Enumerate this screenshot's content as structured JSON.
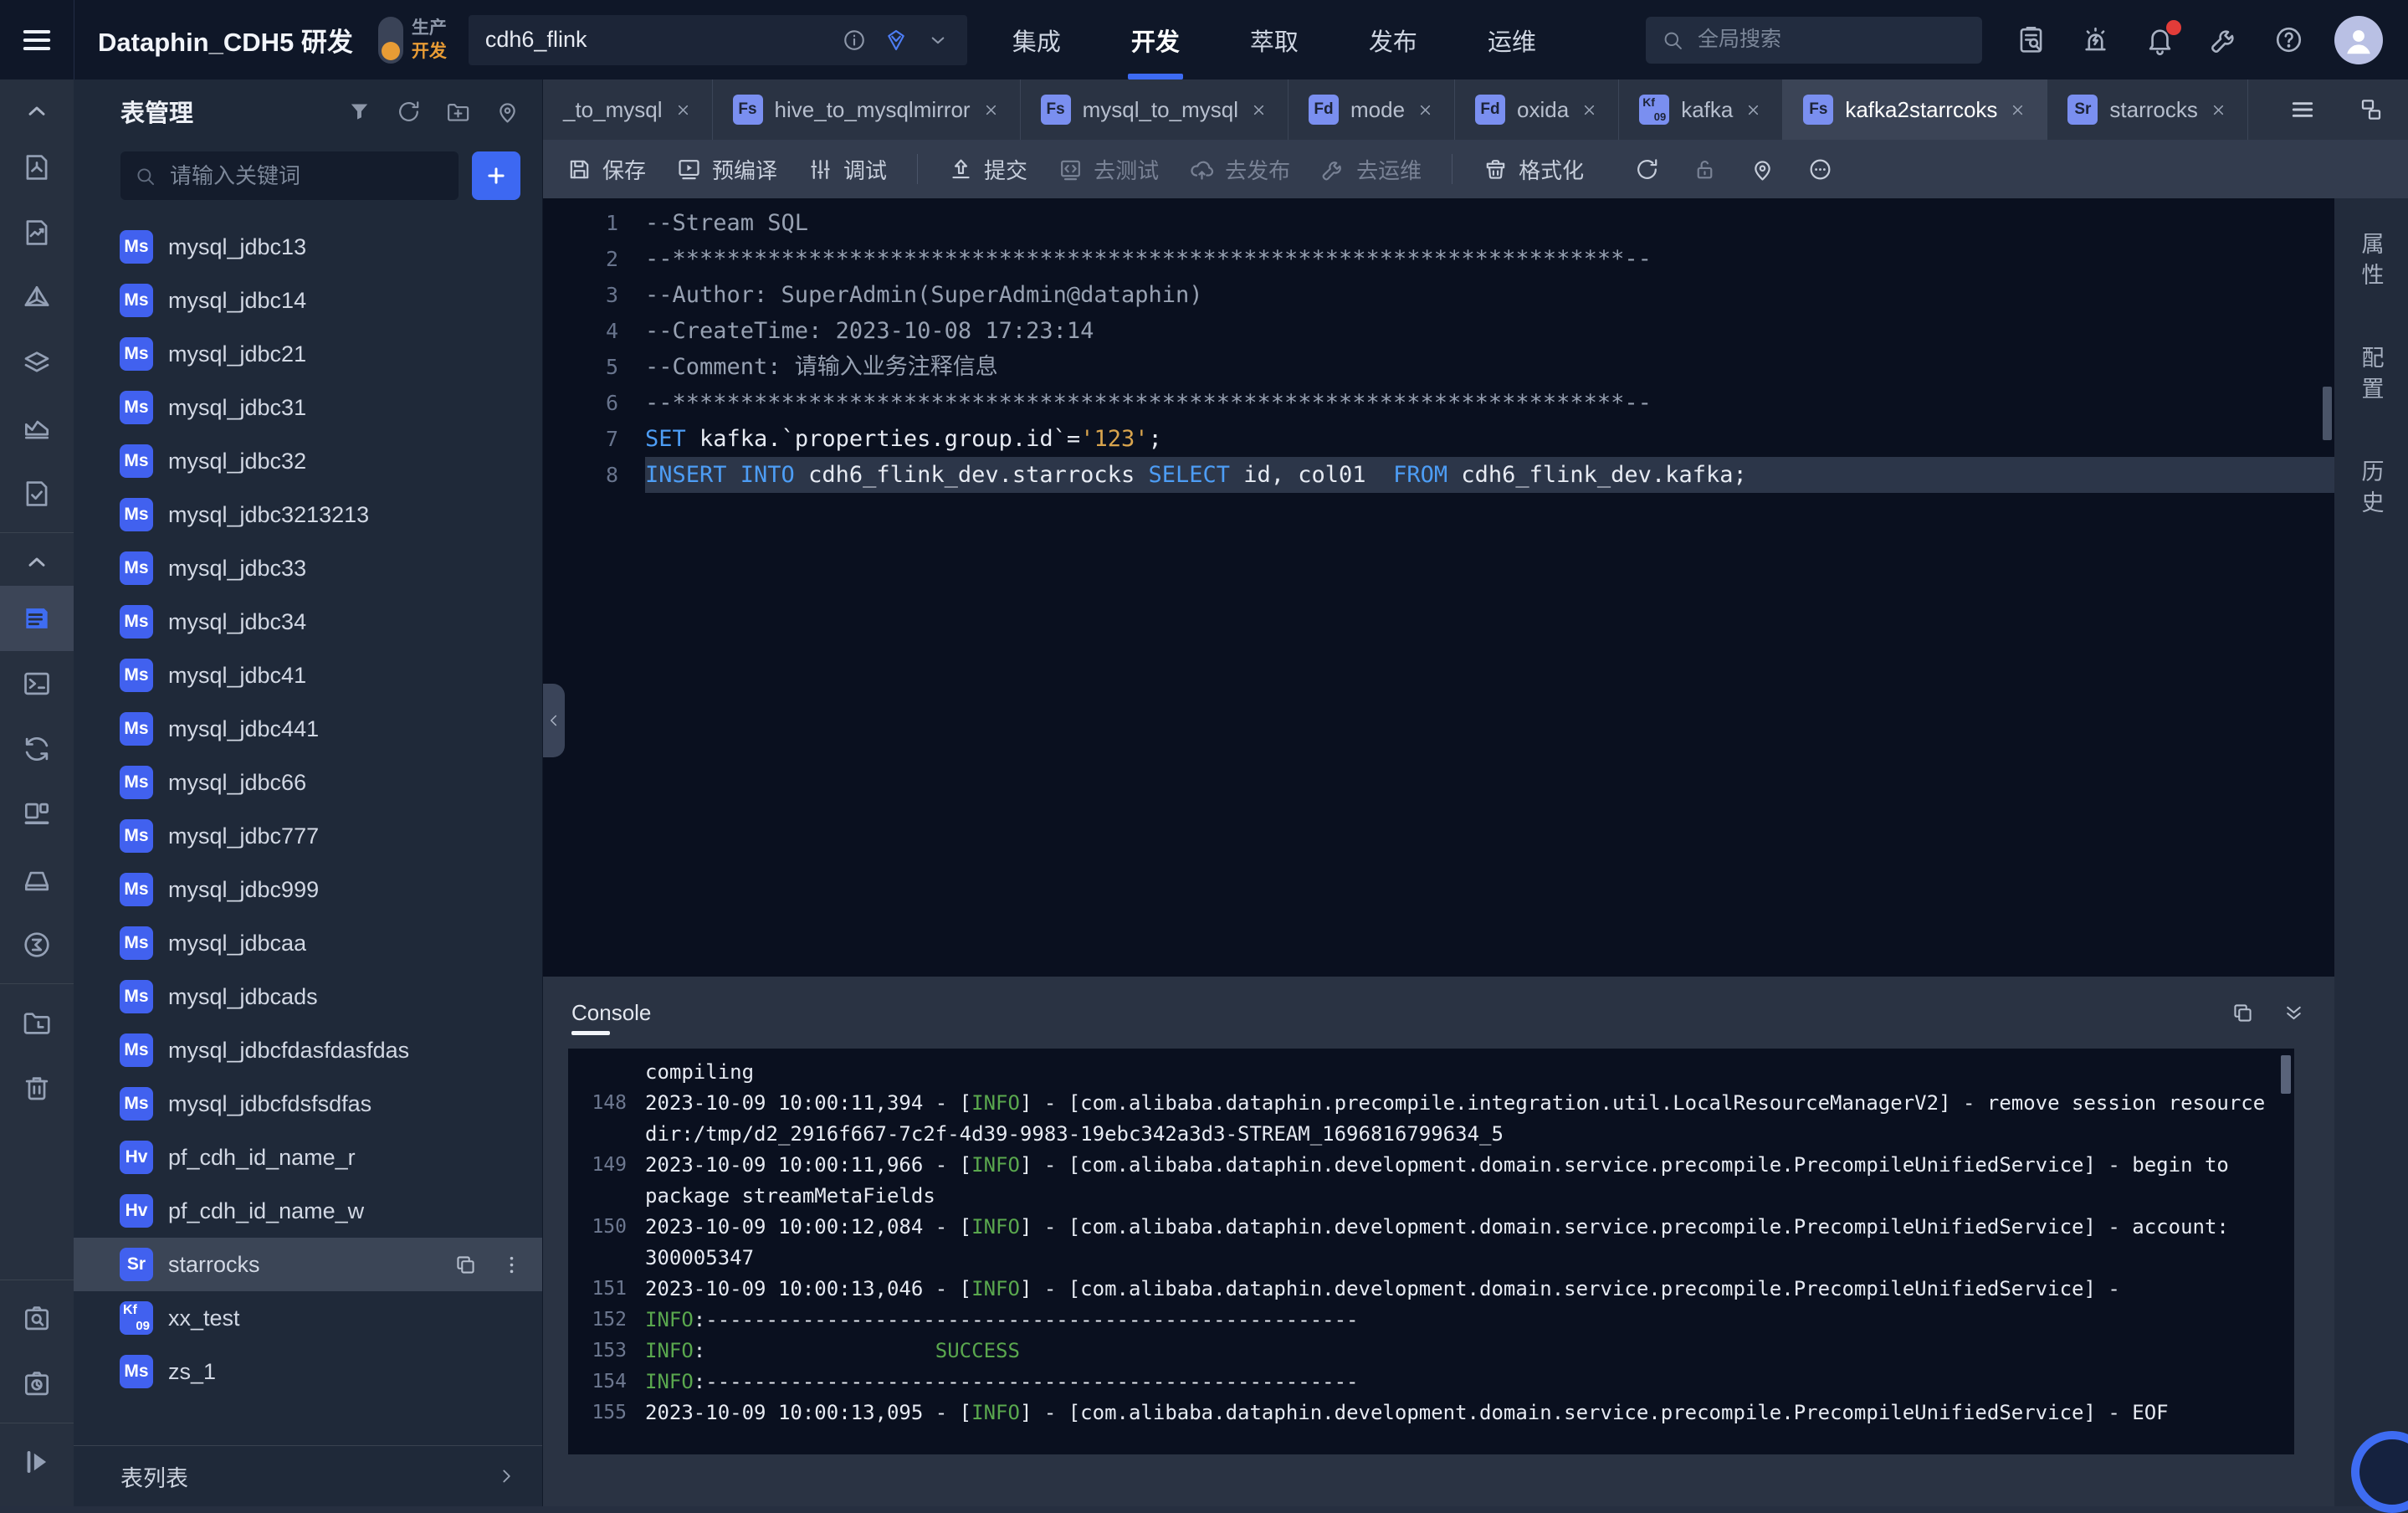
{
  "header": {
    "app_title": "Dataphin_CDH5 研发",
    "env_toggle": {
      "production": "生产",
      "development": "开发"
    },
    "project": {
      "value": "cdh6_flink"
    },
    "nav": [
      {
        "label": "集成",
        "active": false
      },
      {
        "label": "开发",
        "active": true
      },
      {
        "label": "萃取",
        "active": false
      },
      {
        "label": "发布",
        "active": false
      },
      {
        "label": "运维",
        "active": false
      }
    ],
    "global_search_placeholder": "全局搜索",
    "right_icons": [
      {
        "name": "clipboard-search-icon"
      },
      {
        "name": "alarm-icon"
      },
      {
        "name": "bell-icon",
        "badge": true
      },
      {
        "name": "wrench-icon"
      },
      {
        "name": "help-icon"
      }
    ]
  },
  "left_rail": {
    "groups": [
      [
        {
          "name": "chevron-up-icon"
        },
        {
          "name": "doc-flow-icon"
        },
        {
          "name": "doc-chart-icon"
        },
        {
          "name": "pyramid-icon"
        },
        {
          "name": "layers-icon"
        },
        {
          "name": "area-chart-icon"
        },
        {
          "name": "doc-check-icon"
        }
      ],
      [
        {
          "name": "chevron-up-icon"
        },
        {
          "name": "table-manage-icon",
          "active": true
        },
        {
          "name": "terminal-icon"
        },
        {
          "name": "sync-icon"
        },
        {
          "name": "dashboard-icon"
        },
        {
          "name": "tray-icon"
        },
        {
          "name": "sigma-icon"
        }
      ],
      [
        {
          "name": "folder-clock-icon"
        },
        {
          "name": "trash-icon"
        }
      ],
      [
        {
          "name": "doc-search-icon"
        },
        {
          "name": "history-icon"
        }
      ],
      [
        {
          "name": "run-icon"
        }
      ]
    ]
  },
  "table_panel": {
    "title": "表管理",
    "header_icons": [
      {
        "name": "filter-icon"
      },
      {
        "name": "refresh-icon"
      },
      {
        "name": "folder-plus-icon"
      },
      {
        "name": "location-pin-icon"
      }
    ],
    "search_placeholder": "请输入关键词",
    "items": [
      {
        "badge": "Ms",
        "name": "mysql_jdbc13"
      },
      {
        "badge": "Ms",
        "name": "mysql_jdbc14"
      },
      {
        "badge": "Ms",
        "name": "mysql_jdbc21"
      },
      {
        "badge": "Ms",
        "name": "mysql_jdbc31"
      },
      {
        "badge": "Ms",
        "name": "mysql_jdbc32"
      },
      {
        "badge": "Ms",
        "name": "mysql_jdbc3213213"
      },
      {
        "badge": "Ms",
        "name": "mysql_jdbc33"
      },
      {
        "badge": "Ms",
        "name": "mysql_jdbc34"
      },
      {
        "badge": "Ms",
        "name": "mysql_jdbc41"
      },
      {
        "badge": "Ms",
        "name": "mysql_jdbc441"
      },
      {
        "badge": "Ms",
        "name": "mysql_jdbc66"
      },
      {
        "badge": "Ms",
        "name": "mysql_jdbc777"
      },
      {
        "badge": "Ms",
        "name": "mysql_jdbc999"
      },
      {
        "badge": "Ms",
        "name": "mysql_jdbcaa"
      },
      {
        "badge": "Ms",
        "name": "mysql_jdbcads"
      },
      {
        "badge": "Ms",
        "name": "mysql_jdbcfdasfdasfdas"
      },
      {
        "badge": "Ms",
        "name": "mysql_jdbcfdsfsdfas"
      },
      {
        "badge": "Hv",
        "name": "pf_cdh_id_name_r"
      },
      {
        "badge": "Hv",
        "name": "pf_cdh_id_name_w"
      },
      {
        "badge": "Sr",
        "name": "starrocks",
        "selected": true
      },
      {
        "badge": "Kf",
        "badge_sub": "09",
        "name": "xx_test"
      },
      {
        "badge": "Ms",
        "name": "zs_1"
      }
    ],
    "footer": {
      "label": "表列表"
    }
  },
  "tabs": [
    {
      "label": "_to_mysql"
    },
    {
      "badge": "Fs",
      "label": "hive_to_mysqlmirror"
    },
    {
      "badge": "Fs",
      "label": "mysql_to_mysql"
    },
    {
      "badge": "Fd",
      "label": "mode"
    },
    {
      "badge": "Fd",
      "label": "oxida"
    },
    {
      "badge": "Kf",
      "badge_sub": "09",
      "label": "kafka"
    },
    {
      "badge": "Fs",
      "label": "kafka2starrcoks",
      "active": true
    },
    {
      "badge": "Sr",
      "label": "starrocks"
    }
  ],
  "toolbar": {
    "groups": [
      [
        {
          "icon": "save-icon",
          "label": "保存"
        },
        {
          "icon": "precompile-icon",
          "label": "预编译"
        },
        {
          "icon": "debug-icon",
          "label": "调试"
        }
      ],
      [
        {
          "icon": "submit-icon",
          "label": "提交"
        },
        {
          "icon": "code-test-icon",
          "label": "去测试",
          "disabled": true
        },
        {
          "icon": "cloud-publish-icon",
          "label": "去发布",
          "disabled": true
        },
        {
          "icon": "ops-wrench-icon",
          "label": "去运维",
          "disabled": true
        }
      ],
      [
        {
          "icon": "format-icon",
          "label": "格式化"
        }
      ]
    ],
    "right_icons": [
      {
        "icon": "refresh-icon"
      },
      {
        "icon": "lock-open-icon",
        "disabled": true
      },
      {
        "icon": "location-pin-icon"
      },
      {
        "icon": "ellipsis-circle-icon"
      }
    ]
  },
  "editor": {
    "lines": [
      {
        "n": "1",
        "segs": [
          {
            "c": "comment",
            "t": "--Stream SQL"
          }
        ]
      },
      {
        "n": "2",
        "segs": [
          {
            "c": "comment",
            "t": "--**********************************************************************--"
          }
        ]
      },
      {
        "n": "3",
        "segs": [
          {
            "c": "comment",
            "t": "--Author: SuperAdmin(SuperAdmin@dataphin)"
          }
        ]
      },
      {
        "n": "4",
        "segs": [
          {
            "c": "comment",
            "t": "--CreateTime: 2023-10-08 17:23:14"
          }
        ]
      },
      {
        "n": "5",
        "segs": [
          {
            "c": "comment",
            "t": "--Comment: 请输入业务注释信息"
          }
        ]
      },
      {
        "n": "6",
        "segs": [
          {
            "c": "comment",
            "t": "--**********************************************************************--"
          }
        ]
      },
      {
        "n": "7",
        "segs": [
          {
            "c": "kw",
            "t": "SET"
          },
          {
            "c": "plain",
            "t": " kafka.`properties.group.id`="
          },
          {
            "c": "str",
            "t": "'123'"
          },
          {
            "c": "plain",
            "t": ";"
          }
        ]
      },
      {
        "n": "8",
        "active": true,
        "segs": [
          {
            "c": "kw",
            "t": "INSERT INTO"
          },
          {
            "c": "plain",
            "t": " cdh6_flink_dev.starrocks "
          },
          {
            "c": "kw",
            "t": "SELECT"
          },
          {
            "c": "plain",
            "t": " id, col01  "
          },
          {
            "c": "kw",
            "t": "FROM"
          },
          {
            "c": "plain",
            "t": " cdh6_flink_dev.kafka;"
          }
        ]
      }
    ]
  },
  "console": {
    "title": "Console",
    "lines": [
      {
        "n": "",
        "segs": [
          {
            "c": "plain",
            "t": "compiling"
          }
        ]
      },
      {
        "n": "148",
        "segs": [
          {
            "c": "plain",
            "t": "2023-10-09 10:00:11,394 - ["
          },
          {
            "c": "info",
            "t": "INFO"
          },
          {
            "c": "plain",
            "t": "] - [com.alibaba.dataphin.precompile.integration.util.LocalResourceManagerV2] - remove session resource dir:/tmp/d2_2916f667-7c2f-4d39-9983-19ebc342a3d3-STREAM_1696816799634_5"
          }
        ]
      },
      {
        "n": "149",
        "segs": [
          {
            "c": "plain",
            "t": "2023-10-09 10:00:11,966 - ["
          },
          {
            "c": "info",
            "t": "INFO"
          },
          {
            "c": "plain",
            "t": "] - [com.alibaba.dataphin.development.domain.service.precompile.PrecompileUnifiedService] - begin to package streamMetaFields"
          }
        ]
      },
      {
        "n": "150",
        "segs": [
          {
            "c": "plain",
            "t": "2023-10-09 10:00:12,084 - ["
          },
          {
            "c": "info",
            "t": "INFO"
          },
          {
            "c": "plain",
            "t": "] - [com.alibaba.dataphin.development.domain.service.precompile.PrecompileUnifiedService] - account: 300005347"
          }
        ]
      },
      {
        "n": "151",
        "segs": [
          {
            "c": "plain",
            "t": "2023-10-09 10:00:13,046 - ["
          },
          {
            "c": "info",
            "t": "INFO"
          },
          {
            "c": "plain",
            "t": "] - [com.alibaba.dataphin.development.domain.service.precompile.PrecompileUnifiedService] -"
          }
        ]
      },
      {
        "n": "152",
        "segs": [
          {
            "c": "info",
            "t": "INFO"
          },
          {
            "c": "plain",
            "t": ":------------------------------------------------------"
          }
        ]
      },
      {
        "n": "153",
        "segs": [
          {
            "c": "info",
            "t": "INFO"
          },
          {
            "c": "plain",
            "t": ":                   "
          },
          {
            "c": "info",
            "t": "SUCCESS"
          }
        ]
      },
      {
        "n": "154",
        "segs": [
          {
            "c": "info",
            "t": "INFO"
          },
          {
            "c": "plain",
            "t": ":------------------------------------------------------"
          }
        ]
      },
      {
        "n": "155",
        "segs": [
          {
            "c": "plain",
            "t": "2023-10-09 10:00:13,095 - ["
          },
          {
            "c": "info",
            "t": "INFO"
          },
          {
            "c": "plain",
            "t": "] - [com.alibaba.dataphin.development.domain.service.precompile.PrecompileUnifiedService] - EOF"
          }
        ]
      }
    ]
  },
  "right_rail": {
    "tabs": [
      {
        "label": "属性"
      },
      {
        "label": "配置"
      },
      {
        "label": "历史"
      }
    ]
  }
}
